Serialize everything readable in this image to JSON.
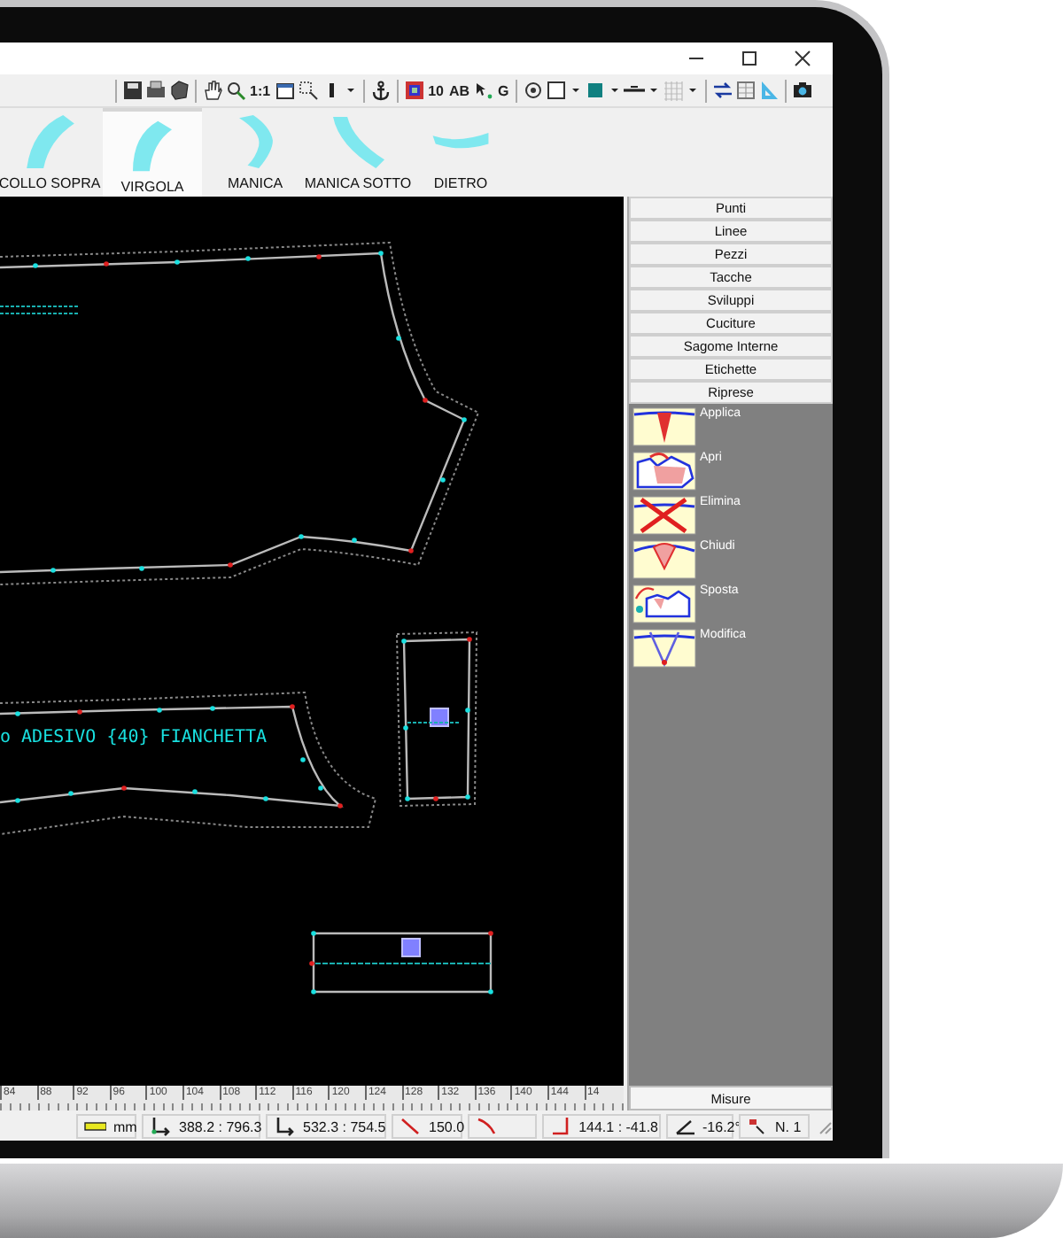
{
  "toolbar": {
    "labels": [
      "1:1",
      "10",
      "AB",
      "G"
    ]
  },
  "pieces": [
    {
      "label": "COLLO SOPRA",
      "selected": false
    },
    {
      "label": "VIRGOLA",
      "selected": true
    },
    {
      "label": "MANICA",
      "selected": false
    },
    {
      "label": "MANICA SOTTO",
      "selected": false
    },
    {
      "label": "DIETRO",
      "selected": false
    }
  ],
  "canvas": {
    "label": "o ADESIVO {40} FIANCHETTA"
  },
  "ruler": {
    "labels": [
      "84",
      "88",
      "92",
      "96",
      "100",
      "104",
      "108",
      "112",
      "116",
      "120",
      "124",
      "128",
      "132",
      "136",
      "140",
      "144",
      "14"
    ]
  },
  "panel": {
    "sections": [
      {
        "label": "Punti"
      },
      {
        "label": "Linee"
      },
      {
        "label": "Pezzi"
      },
      {
        "label": "Tacche"
      },
      {
        "label": "Sviluppi"
      },
      {
        "label": "Cuciture"
      },
      {
        "label": "Sagome Interne"
      },
      {
        "label": "Etichette"
      },
      {
        "label": "Riprese"
      }
    ],
    "tools": [
      {
        "kind": "apply",
        "label": "Applica"
      },
      {
        "kind": "open",
        "label": "Apri"
      },
      {
        "kind": "delete",
        "label": "Elimina"
      },
      {
        "kind": "close",
        "label": "Chiudi"
      },
      {
        "kind": "move",
        "label": "Sposta"
      },
      {
        "kind": "modify",
        "label": "Modifica"
      }
    ],
    "footer_button": "Misure"
  },
  "status_bar": [
    {
      "kind": "units",
      "text": "mm"
    },
    {
      "kind": "start",
      "text": "388.2 : 796.3"
    },
    {
      "kind": "end",
      "text": "532.3 : 754.5"
    },
    {
      "kind": "length",
      "text": "150.0"
    },
    {
      "kind": "curve"
    },
    {
      "kind": "offset",
      "text": "144.1 : -41.8"
    },
    {
      "kind": "angle",
      "text": "-16.2°"
    },
    {
      "kind": "piece",
      "text": "N. 1"
    }
  ]
}
